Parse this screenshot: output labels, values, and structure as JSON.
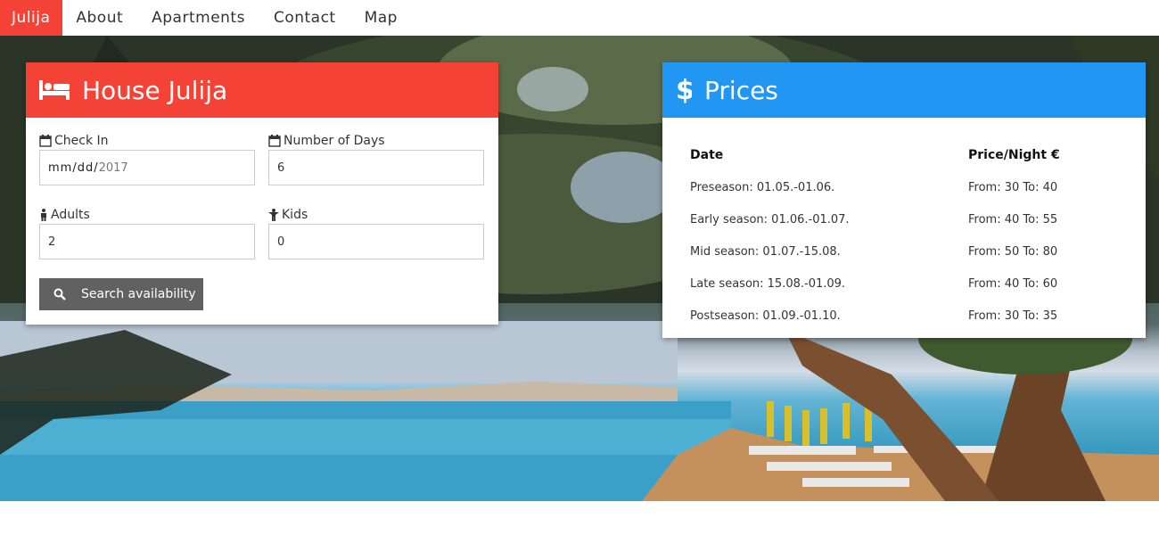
{
  "nav": {
    "items": [
      {
        "label": "Julija",
        "active": true
      },
      {
        "label": "About",
        "active": false
      },
      {
        "label": "Apartments",
        "active": false
      },
      {
        "label": "Contact",
        "active": false
      },
      {
        "label": "Map",
        "active": false
      }
    ]
  },
  "colors": {
    "accent_red": "#f44336",
    "accent_blue": "#2196f3",
    "button_gray": "#616161"
  },
  "booking": {
    "title": "House Julija",
    "icon": "bed-icon",
    "checkin": {
      "label": "Check In",
      "placeholder_a": "mm/dd/",
      "placeholder_b": "2017",
      "icon": "calendar-icon"
    },
    "days": {
      "label": "Number of Days",
      "value": "6",
      "icon": "calendar-icon"
    },
    "adults": {
      "label": "Adults",
      "value": "2",
      "icon": "male-icon"
    },
    "kids": {
      "label": "Kids",
      "value": "0",
      "icon": "child-icon"
    },
    "search_label": "Search availability",
    "search_icon": "search-icon"
  },
  "prices": {
    "title": "Prices",
    "icon": "dollar-icon",
    "headers": [
      "Date",
      "Price/Night €"
    ],
    "rows": [
      [
        "Preseason: 01.05.-01.06.",
        "From: 30 To: 40"
      ],
      [
        "Early season: 01.06.-01.07.",
        "From: 40 To: 55"
      ],
      [
        "Mid season: 01.07.-15.08.",
        "From: 50 To: 80"
      ],
      [
        "Late season: 15.08.-01.09.",
        "From: 40 To: 60"
      ],
      [
        "Postseason: 01.09.-01.10.",
        "From: 30 To: 35"
      ]
    ]
  }
}
